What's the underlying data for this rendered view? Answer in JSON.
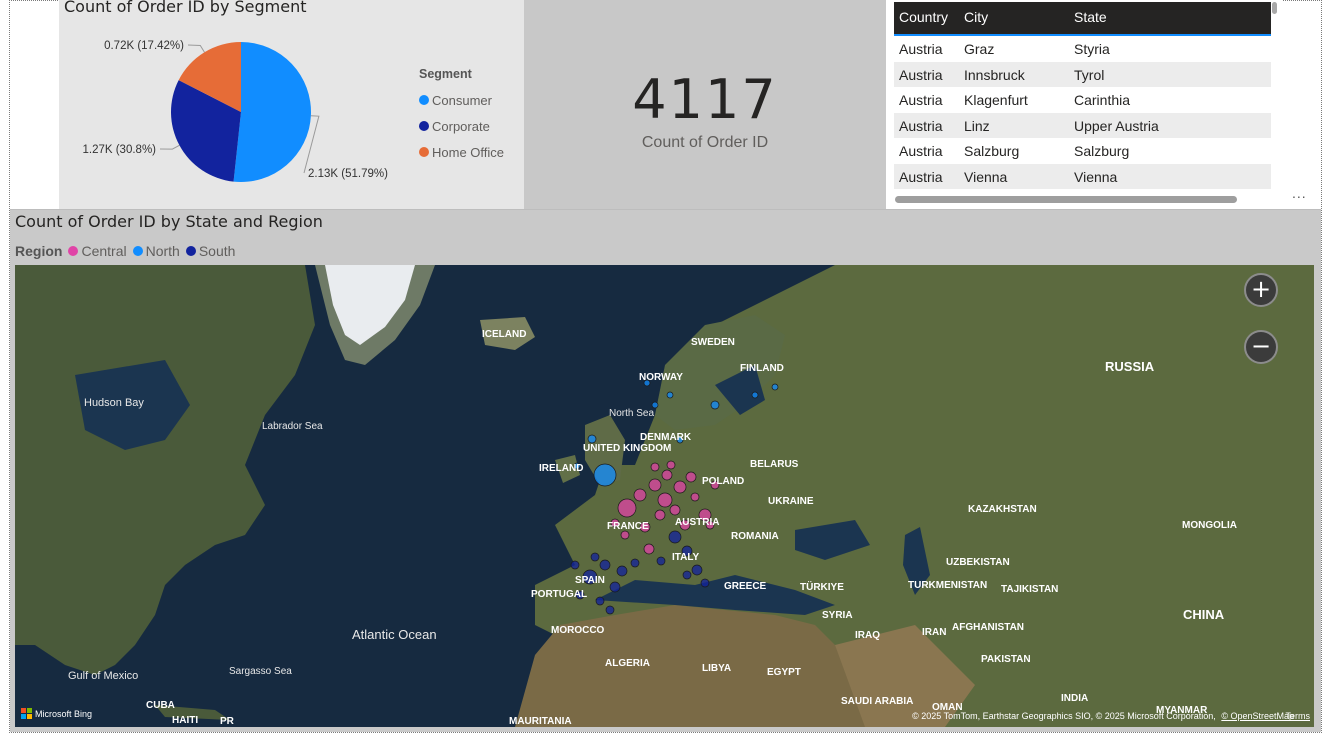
{
  "pie_visual": {
    "title": "Count of Order ID by Segment",
    "legend_title": "Segment",
    "colors": {
      "Consumer": "#118dff",
      "Corporate": "#12239e",
      "Home Office": "#e66c37"
    },
    "chart_data": {
      "type": "pie",
      "title": "Count of Order ID by Segment",
      "categories": [
        "Consumer",
        "Corporate",
        "Home Office"
      ],
      "values": [
        2130,
        1270,
        720
      ],
      "percentages": [
        51.79,
        30.8,
        17.42
      ],
      "data_labels": [
        "2.13K (51.79%)",
        "1.27K (30.8%)",
        "0.72K (17.42%)"
      ],
      "legend_position": "right"
    }
  },
  "card_visual": {
    "value": "4117",
    "label": "Count of Order ID"
  },
  "table_visual": {
    "columns": [
      "Country",
      "City",
      "State"
    ],
    "rows": [
      [
        "Austria",
        "Graz",
        "Styria"
      ],
      [
        "Austria",
        "Innsbruck",
        "Tyrol"
      ],
      [
        "Austria",
        "Klagenfurt",
        "Carinthia"
      ],
      [
        "Austria",
        "Linz",
        "Upper Austria"
      ],
      [
        "Austria",
        "Salzburg",
        "Salzburg"
      ],
      [
        "Austria",
        "Vienna",
        "Vienna"
      ]
    ],
    "more_options": "..."
  },
  "map_visual": {
    "title": "Count of Order ID by State and Region",
    "legend_title": "Region",
    "legend": [
      {
        "name": "Central",
        "color": "#e044a7"
      },
      {
        "name": "North",
        "color": "#118dff"
      },
      {
        "name": "South",
        "color": "#12239e"
      }
    ],
    "zoom_in": "+",
    "zoom_out": "−",
    "bing_logo": "Microsoft Bing",
    "attribution": "© 2025 TomTom, Earthstar Geographics SIO, © 2025 Microsoft Corporation,",
    "attribution_link": "© OpenStreetMap",
    "terms": "Terms",
    "labels": {
      "russia": "RUSSIA",
      "china": "CHINA",
      "mongolia": "MONGOLIA",
      "kazakhstan": "KAZAKHSTAN",
      "iceland": "ICELAND",
      "sweden": "SWEDEN",
      "finland": "FINLAND",
      "norway": "NORWAY",
      "north_sea": "North Sea",
      "denmark": "DENMARK",
      "uk": "UNITED KINGDOM",
      "ireland": "IRELAND",
      "belarus": "BELARUS",
      "poland": "POLAND",
      "ukraine": "UKRAINE",
      "france": "FRANCE",
      "austria": "AUSTRIA",
      "romania": "ROMANIA",
      "italy": "ITALY",
      "spain": "SPAIN",
      "portugal": "PORTUGAL",
      "greece": "GREECE",
      "turkiye": "TÜRKIYE",
      "syria": "SYRIA",
      "iraq": "IRAQ",
      "iran": "IRAN",
      "turkmenistan": "TURKMENISTAN",
      "uzbekistan": "UZBEKISTAN",
      "tajikistan": "TAJIKISTAN",
      "afghanistan": "AFGHANISTAN",
      "pakistan": "PAKISTAN",
      "india": "INDIA",
      "myanmar": "MYANMAR",
      "oman": "OMAN",
      "saudi": "SAUDI ARABIA",
      "egypt": "EGYPT",
      "libya": "LIBYA",
      "algeria": "ALGERIA",
      "morocco": "MOROCCO",
      "mauritania": "MAURITANIA",
      "cuba": "CUBA",
      "haiti": "HAITI",
      "pr": "PR",
      "hudson": "Hudson Bay",
      "labrador": "Labrador Sea",
      "atlantic": "Atlantic Ocean",
      "sargasso": "Sargasso Sea",
      "gulf_mexico": "Gulf of Mexico"
    }
  }
}
